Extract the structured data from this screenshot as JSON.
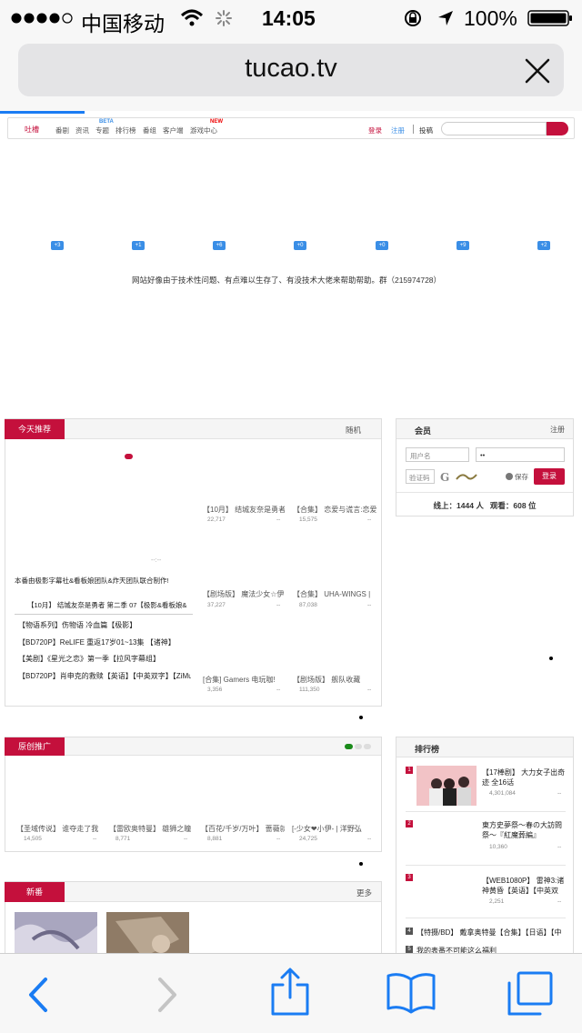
{
  "status": {
    "carrier": "中国移动",
    "time": "14:05",
    "battery": "100%"
  },
  "browser": {
    "url": "tucao.tv"
  },
  "nav": {
    "logo": "吐槽",
    "items": [
      "新番",
      "番剧",
      "资讯",
      "专题",
      "排行榜",
      "番组",
      "客户端",
      "游戏中心"
    ],
    "beta": "BETA",
    "new": "NEW",
    "login": "登录",
    "register": "注册",
    "submit": "投稿"
  },
  "bubbles": [
    "+3",
    "+1",
    "+6",
    "+0",
    "+0",
    "+9",
    "+2"
  ],
  "notice": "网站好像由于技术性问题、有点难以生存了、有没技术大佬来帮助帮助。群（215974728）",
  "today": {
    "tab": "今天推荐",
    "random": "随机",
    "feature_note": "本番由极影字幕社&看板娘团队&炸天团队联合制作!",
    "feature_title": "【10月】 结城友奈是勇者 第二季 07【极影&看板娘&",
    "list": [
      "【物语系列】伤物语 冷血篇【极影】",
      "【BD720P】ReLIFE 重返17岁01~13集 【诸神】",
      "【美剧】《星光之恋》第一季【拉风字幕组】",
      "【BD720P】肖申克的救赎【英语】【中英双字】【ZiMu"
    ],
    "grid": [
      {
        "title": "【10月】 结城友奈是勇者",
        "views": "22,717",
        "extra": "--"
      },
      {
        "title": "【合集】 恋爱与谎言:恋爱",
        "views": "15,575",
        "extra": "--"
      },
      {
        "title": "【剧场版】 魔法少女☆伊",
        "views": "37,227",
        "extra": "--"
      },
      {
        "title": "【合集】 UHA-WINGS |",
        "views": "87,038",
        "extra": "--"
      },
      {
        "title": "[合集] Gamers 电玩咖!",
        "views": "3,356",
        "extra": "--"
      },
      {
        "title": "【剧场版】 舰队收藏",
        "views": "111,350",
        "extra": "--"
      }
    ]
  },
  "member": {
    "title": "会员",
    "register": "注册",
    "user_placeholder": "用户名",
    "pass_value": "••",
    "captcha_placeholder": "验证码",
    "save": "保存",
    "login": "登录",
    "online": "线上：1444 人   观看：608 位"
  },
  "original": {
    "tab": "原创推广",
    "items": [
      {
        "title": "【圣域传说】 谁夺走了我",
        "views": "14,505",
        "extra": "--"
      },
      {
        "title": "【雷欧奥特曼】 雄狮之瞳",
        "views": "8,771",
        "extra": "--"
      },
      {
        "title": "【百花/千岁/万叶】 蔷薇就",
        "views": "8,881",
        "extra": "--"
      },
      {
        "title": "[-少女❤小伊- | 洋野弘",
        "views": "24,725",
        "extra": "--"
      }
    ]
  },
  "ranking": {
    "title": "排行榜",
    "items": [
      {
        "rank": "1",
        "title": "【17棒剧】 大力女子出奇迹 全16话",
        "views": "4,301,084",
        "extra": "--"
      },
      {
        "rank": "2",
        "title": "東方史夢祭～春の大訪問祭～『紅魔葬編』",
        "views": "10,360",
        "extra": "--"
      },
      {
        "rank": "3",
        "title": "【WEB1080P】 雷神3:诸神黄昏【英语】【中英双",
        "views": "2,251",
        "extra": "--"
      }
    ],
    "more": [
      {
        "rank": "4",
        "title": "【特摄/BD】 戴拿奥特曼【合集】【日语】【中"
      },
      {
        "rank": "5",
        "title": "我的表番不可能这么福利"
      }
    ]
  },
  "xinfan": {
    "tab": "新番",
    "more": "更多"
  }
}
